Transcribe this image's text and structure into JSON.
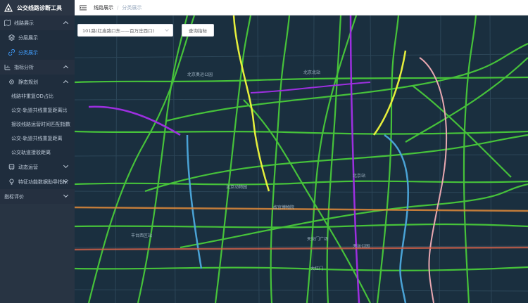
{
  "app": {
    "title": "公交线路诊断工具"
  },
  "sidebar": {
    "groups": [
      {
        "label": "线路展示",
        "icon": "map-icon",
        "items": [
          {
            "label": "分层展示",
            "icon": "layers-icon"
          },
          {
            "label": "分类展示",
            "icon": "link-icon",
            "active": true
          }
        ]
      },
      {
        "label": "指标分析",
        "icon": "chart-icon",
        "subgroups": [
          {
            "label": "静态规划",
            "icon": "gear-icon",
            "items": [
              {
                "label": "线路非重复OD占比"
              },
              {
                "label": "公交-轨道共线重复距离比"
              },
              {
                "label": "接驳线路运营时间匹配指数"
              },
              {
                "label": "公交-轨道共线重复距离"
              },
              {
                "label": "公交轨道接驳距离"
              }
            ]
          },
          {
            "label": "动态运营",
            "icon": "bus-icon"
          },
          {
            "label": "特征功能数据助导指标",
            "icon": "bulb-icon"
          }
        ]
      },
      {
        "label": "指标评价"
      }
    ]
  },
  "header": {
    "breadcrumb": [
      "线路展示",
      "分类展示"
    ],
    "separator": "/"
  },
  "map": {
    "route_select": {
      "value": "101路(红庙路口东——百万庄西口)"
    },
    "query_button": "查询指标",
    "labels": [
      "北京奥运公园",
      "北京北站",
      "北京站",
      "北京动物园",
      "天安门广场",
      "大红门",
      "天坛公园",
      "丰台西区站",
      "故宫博物院"
    ],
    "colors": {
      "background": "#1a2f3f",
      "bright_green": "#4bd23a",
      "yellow": "#e6ef3c",
      "purple": "#9d2fe0",
      "blue": "#4aa3d6",
      "pink": "#e8a7b0",
      "orange": "#e08a3a"
    }
  }
}
